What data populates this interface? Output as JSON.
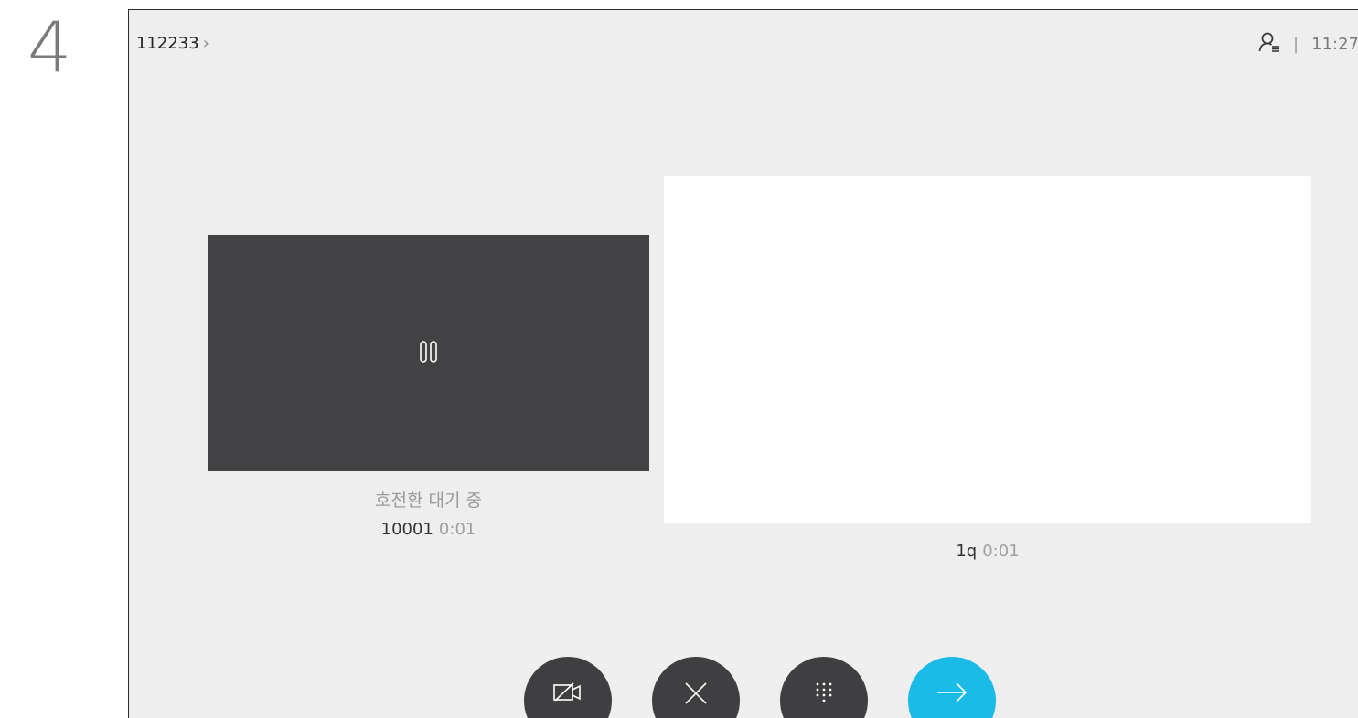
{
  "step_number": "4",
  "header": {
    "title": "112233",
    "chevron": "›",
    "time": "11:27"
  },
  "held_call": {
    "status": "호전환 대기 중",
    "name": "10001",
    "duration": "0:01",
    "icon": "pause-icon"
  },
  "active_call": {
    "name": "1q",
    "duration": "0:01"
  },
  "controls": [
    {
      "name": "video-off-button",
      "icon": "video-off-icon"
    },
    {
      "name": "end-call-button",
      "icon": "close-icon"
    },
    {
      "name": "keypad-button",
      "icon": "keypad-icon"
    },
    {
      "name": "transfer-button",
      "icon": "arrow-right-icon"
    }
  ],
  "colors": {
    "background": "#eeeeee",
    "held_tile": "#424244",
    "button": "#3f3f41",
    "accent": "#1bbbe8"
  }
}
